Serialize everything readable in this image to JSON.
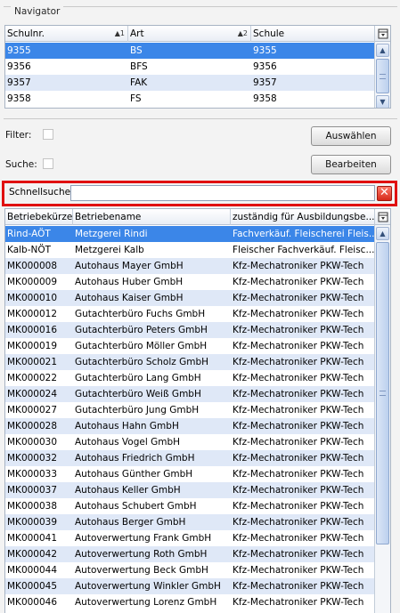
{
  "navigator": {
    "title": "Navigator",
    "columns": [
      {
        "label": "Schulnr.",
        "sort": "▲1"
      },
      {
        "label": "Art",
        "sort": "▲2"
      },
      {
        "label": "Schule",
        "sort": ""
      }
    ],
    "rows": [
      [
        "9355",
        "BS",
        "9355"
      ],
      [
        "9356",
        "BFS",
        "9356"
      ],
      [
        "9357",
        "FAK",
        "9357"
      ],
      [
        "9358",
        "FS",
        "9358"
      ]
    ],
    "selected_row": 0
  },
  "filter": {
    "filter_label": "Filter:",
    "search_label": "Suche:",
    "select_button": "Auswählen",
    "edit_button": "Bearbeiten"
  },
  "quicksearch": {
    "label": "Schnellsuche",
    "value": "",
    "placeholder": "",
    "clear_icon": "close-icon"
  },
  "companies": {
    "columns": [
      "Betriebekürzel",
      "Betriebename",
      "zuständig für Ausbildungsbe..."
    ],
    "rows": [
      [
        "Rind-AÖT",
        "Metzgerei Rindi",
        "Fachverkäuf. Fleischerei Fleis..."
      ],
      [
        "Kalb-NÖT",
        "Metzgerei Kalb",
        "Fleischer Fachverkäuf. Fleisc..."
      ],
      [
        "MK000008",
        "Autohaus Mayer GmbH",
        "Kfz-Mechatroniker PKW-Tech"
      ],
      [
        "MK000009",
        "Autohaus Huber GmbH",
        "Kfz-Mechatroniker PKW-Tech"
      ],
      [
        "MK000010",
        "Autohaus Kaiser GmbH",
        "Kfz-Mechatroniker PKW-Tech"
      ],
      [
        "MK000012",
        "Gutachterbüro Fuchs GmbH",
        "Kfz-Mechatroniker PKW-Tech"
      ],
      [
        "MK000016",
        "Gutachterbüro Peters GmbH",
        "Kfz-Mechatroniker PKW-Tech"
      ],
      [
        "MK000019",
        "Gutachterbüro Möller GmbH",
        "Kfz-Mechatroniker PKW-Tech"
      ],
      [
        "MK000021",
        "Gutachterbüro Scholz GmbH",
        "Kfz-Mechatroniker PKW-Tech"
      ],
      [
        "MK000022",
        "Gutachterbüro Lang GmbH",
        "Kfz-Mechatroniker PKW-Tech"
      ],
      [
        "MK000024",
        "Gutachterbüro Weiß GmbH",
        "Kfz-Mechatroniker PKW-Tech"
      ],
      [
        "MK000027",
        "Gutachterbüro Jung GmbH",
        "Kfz-Mechatroniker PKW-Tech"
      ],
      [
        "MK000028",
        "Autohaus Hahn GmbH",
        "Kfz-Mechatroniker PKW-Tech"
      ],
      [
        "MK000030",
        "Autohaus Vogel GmbH",
        "Kfz-Mechatroniker PKW-Tech"
      ],
      [
        "MK000032",
        "Autohaus Friedrich GmbH",
        "Kfz-Mechatroniker PKW-Tech"
      ],
      [
        "MK000033",
        "Autohaus Günther GmbH",
        "Kfz-Mechatroniker PKW-Tech"
      ],
      [
        "MK000037",
        "Autohaus Keller GmbH",
        "Kfz-Mechatroniker PKW-Tech"
      ],
      [
        "MK000038",
        "Autohaus Schubert GmbH",
        "Kfz-Mechatroniker PKW-Tech"
      ],
      [
        "MK000039",
        "Autohaus Berger GmbH",
        "Kfz-Mechatroniker PKW-Tech"
      ],
      [
        "MK000041",
        "Autoverwertung Frank GmbH",
        "Kfz-Mechatroniker PKW-Tech"
      ],
      [
        "MK000042",
        "Autoverwertung Roth GmbH",
        "Kfz-Mechatroniker PKW-Tech"
      ],
      [
        "MK000044",
        "Autoverwertung Beck GmbH",
        "Kfz-Mechatroniker PKW-Tech"
      ],
      [
        "MK000045",
        "Autoverwertung Winkler GmbH",
        "Kfz-Mechatroniker PKW-Tech"
      ],
      [
        "MK000046",
        "Autoverwertung Lorenz GmbH",
        "Kfz-Mechatroniker PKW-Tech"
      ]
    ],
    "selected_row": 0
  },
  "colors": {
    "selection": "#3b86e8",
    "alt_row": "#dfe8f7",
    "highlight_border": "#e01010"
  }
}
